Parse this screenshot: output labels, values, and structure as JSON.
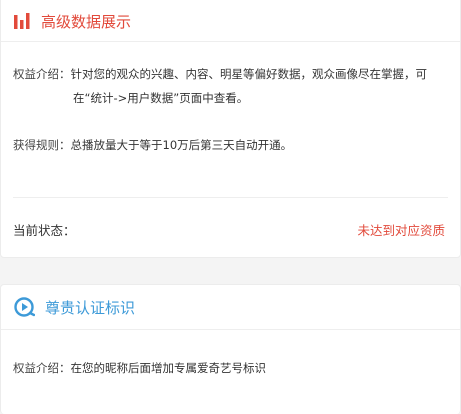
{
  "premium": {
    "title": "高级数据展示",
    "benefit_label": "权益介绍：",
    "benefit_line1": "针对您的观众的兴趣、内容、明星等偏好数据，观众画像尽在掌握，可",
    "benefit_line2": "在“统计->用户数据”页面中查看。",
    "rule_label": "获得规则：",
    "rule_text": "总播放量大于等于10万后第三天自动开通。",
    "status_label": "当前状态：",
    "status_value": "未达到对应资质",
    "accent_color": "#e24a3b",
    "icon": "bar-chart-icon"
  },
  "verify": {
    "title": "尊贵认证标识",
    "benefit_label": "权益介绍：",
    "benefit_text": "在您的昵称后面增加专属爱奇艺号标识",
    "accent_color": "#3d9ad8",
    "icon": "play-circle-icon"
  }
}
